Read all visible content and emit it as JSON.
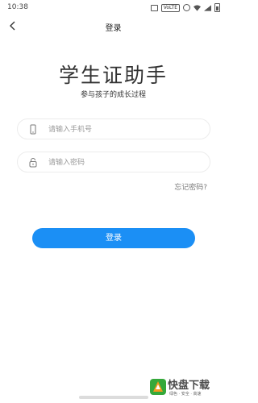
{
  "status_bar": {
    "time": "10:38",
    "volte_label": "VoLTE"
  },
  "header": {
    "title": "登录"
  },
  "main": {
    "app_title": "学生证助手",
    "subtitle": "参与孩子的成长过程",
    "phone_placeholder": "请输入手机号",
    "password_placeholder": "请输入密码",
    "forgot_password": "忘记密码?",
    "login_label": "登录"
  },
  "watermark": {
    "brand": "快盘下载",
    "tagline": "绿色 · 安全 · 高速"
  },
  "colors": {
    "accent": "#1b8ff5",
    "watermark_green": "#35a83a",
    "watermark_orange": "#f39a1e"
  }
}
